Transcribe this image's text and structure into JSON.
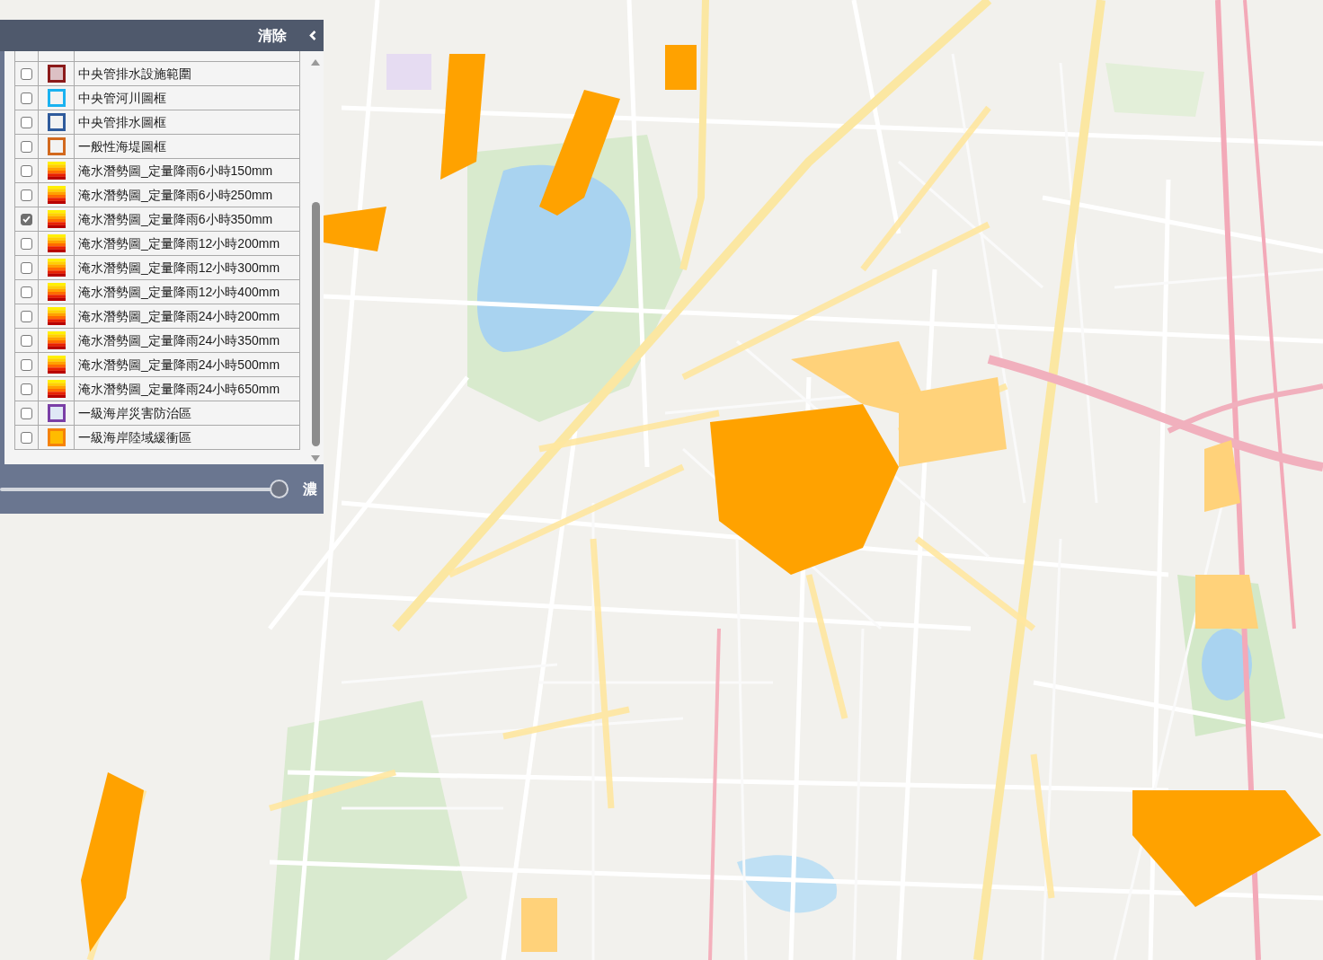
{
  "layer_panel": {
    "clear_button": "清除",
    "layers": [
      {
        "kind": "area",
        "label": "中央管排水設施範圍",
        "color": "#8b1a1a",
        "fill": {
          "color": "#dcc0c4"
        },
        "checked": false
      },
      {
        "kind": "frame",
        "label": "中央管河川圖框",
        "color": "#1ab2f0",
        "checked": false
      },
      {
        "kind": "frame",
        "label": "中央管排水圖框",
        "color": "#2f5b9c",
        "checked": false
      },
      {
        "kind": "frame",
        "label": "一般性海堤圖框",
        "color": "#d2691e",
        "checked": false
      },
      {
        "kind": "gradient",
        "label": "淹水潛勢圖_定量降雨6小時150mm",
        "checked": false
      },
      {
        "kind": "gradient",
        "label": "淹水潛勢圖_定量降雨6小時250mm",
        "checked": false
      },
      {
        "kind": "gradient",
        "label": "淹水潛勢圖_定量降雨6小時350mm",
        "checked": true
      },
      {
        "kind": "gradient",
        "label": "淹水潛勢圖_定量降雨12小時200mm",
        "checked": false
      },
      {
        "kind": "gradient",
        "label": "淹水潛勢圖_定量降雨12小時300mm",
        "checked": false
      },
      {
        "kind": "gradient",
        "label": "淹水潛勢圖_定量降雨12小時400mm",
        "checked": false
      },
      {
        "kind": "gradient",
        "label": "淹水潛勢圖_定量降雨24小時200mm",
        "checked": false
      },
      {
        "kind": "gradient",
        "label": "淹水潛勢圖_定量降雨24小時350mm",
        "checked": false
      },
      {
        "kind": "gradient",
        "label": "淹水潛勢圖_定量降雨24小時500mm",
        "checked": false
      },
      {
        "kind": "gradient",
        "label": "淹水潛勢圖_定量降雨24小時650mm",
        "checked": false
      },
      {
        "kind": "area",
        "label": "一級海岸災害防治區",
        "color": "#7a3fa6",
        "fill": {
          "color": "#dfe8f6"
        },
        "checked": false
      },
      {
        "kind": "area",
        "label": "一級海岸陸域緩衝區",
        "color": "#f5820a",
        "fill": {
          "color": "#ffbb00"
        },
        "checked": false
      }
    ],
    "opacity_slider": {
      "level": 1,
      "label": "濃"
    }
  }
}
